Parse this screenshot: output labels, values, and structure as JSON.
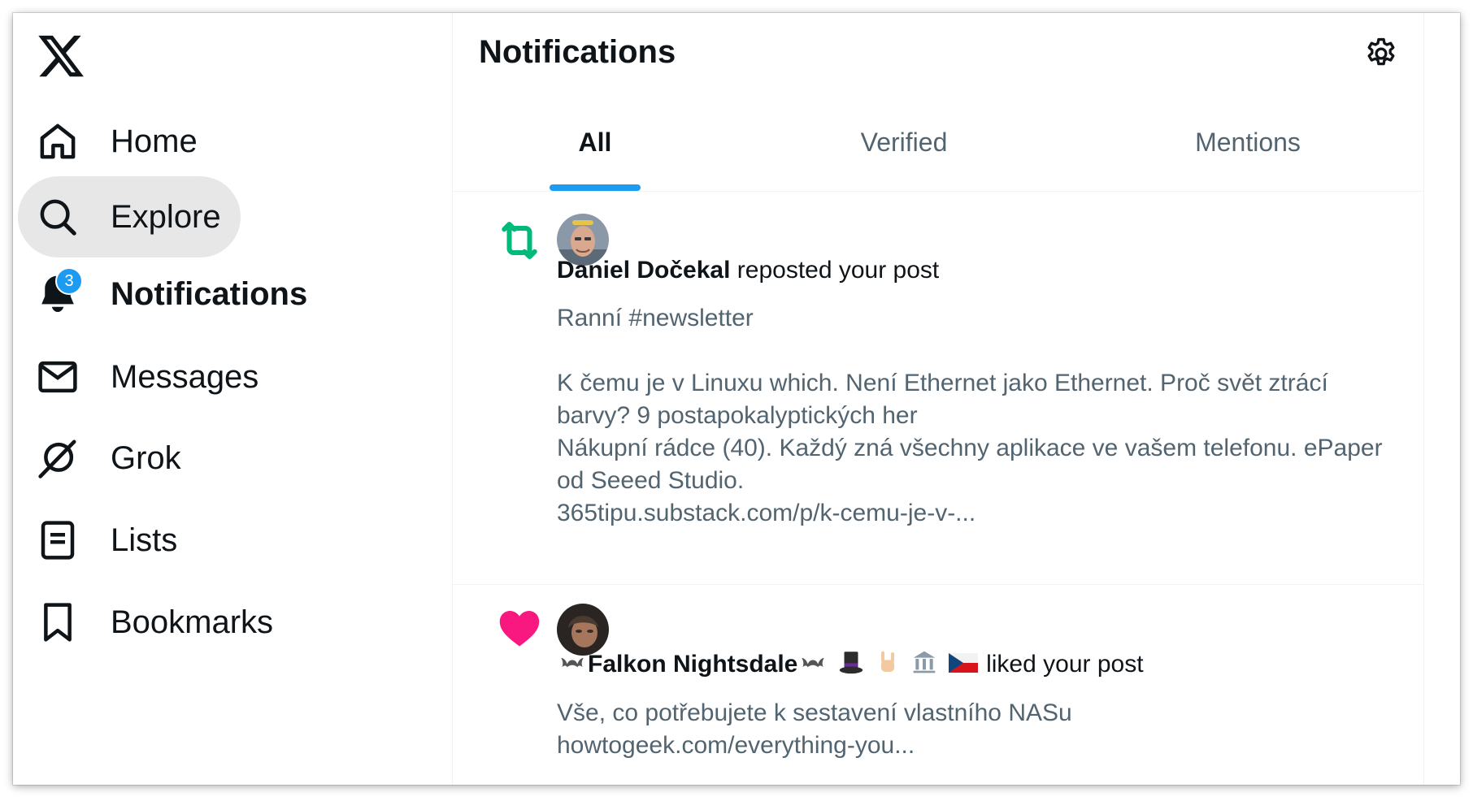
{
  "brand": {
    "logo_icon": "x-logo-icon"
  },
  "sidebar": {
    "items": [
      {
        "label": "Home",
        "icon": "home-icon"
      },
      {
        "label": "Explore",
        "icon": "search-icon",
        "active": true
      },
      {
        "label": "Notifications",
        "icon": "bell-icon",
        "badge": "3",
        "bold": true
      },
      {
        "label": "Messages",
        "icon": "envelope-icon"
      },
      {
        "label": "Grok",
        "icon": "grok-icon"
      },
      {
        "label": "Lists",
        "icon": "list-icon"
      },
      {
        "label": "Bookmarks",
        "icon": "bookmark-icon"
      }
    ]
  },
  "header": {
    "title": "Notifications",
    "settings_icon": "gear-icon"
  },
  "tabs": [
    {
      "label": "All",
      "active": true
    },
    {
      "label": "Verified"
    },
    {
      "label": "Mentions"
    }
  ],
  "notifications": [
    {
      "type": "repost",
      "user": "Daniel Dočekal",
      "action": "reposted your post",
      "lines": [
        "Ranní #newsletter",
        "",
        "K čemu je v Linuxu which. Není Ethernet jako Ethernet. Proč svět ztrácí barvy? 9 postapokalyptických her",
        "Nákupní rádce (40). Každý zná všechny aplikace ve vašem telefonu. ePaper od Seeed Studio.",
        "365tipu.substack.com/p/k-cemu-je-v-..."
      ]
    },
    {
      "type": "like",
      "user": "Falkon Nightsdale",
      "action": "liked your post",
      "lines": [
        "Vše, co potřebujete k sestavení vlastního NASu",
        "howtogeek.com/everything-you..."
      ]
    }
  ],
  "colors": {
    "accent": "#1d9bf0",
    "repost": "#00ba7c",
    "like": "#f91880",
    "muted": "#536471"
  }
}
